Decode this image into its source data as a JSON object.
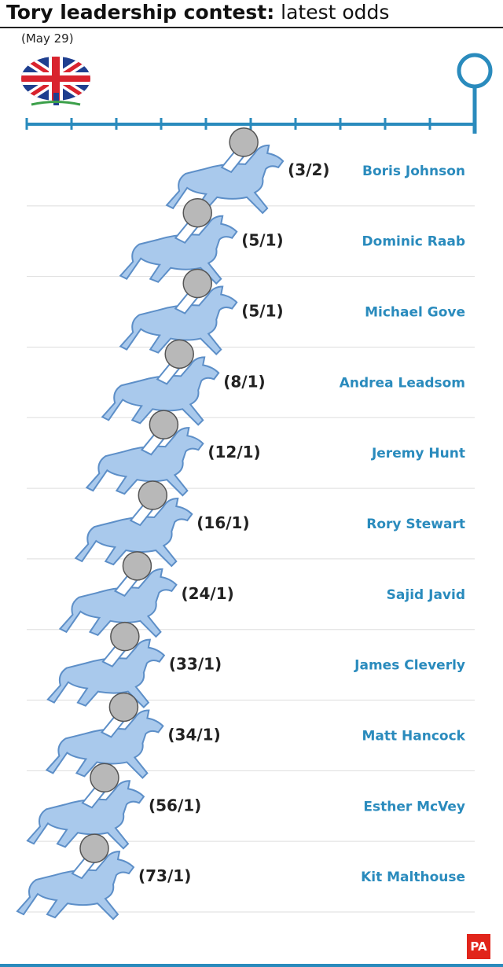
{
  "title": {
    "bold": "Tory leadership contest:",
    "rest": " latest odds"
  },
  "date_note": "(May 29)",
  "colors": {
    "accent": "#2a8bbd",
    "horse": "#a9c9ec",
    "horse_stroke": "#5d8fc8",
    "rule": "#dddddd",
    "pa_red": "#e1251b"
  },
  "icons": [
    "union-jack-tree-logo",
    "finish-post-icon",
    "racehorse-icon",
    "jockey-face-icon"
  ],
  "pa_logo": "PA",
  "chart_data": {
    "type": "bar",
    "title": "Tory leadership contest: latest odds",
    "subtitle": "(May 29)",
    "value_meaning": "betting odds (fractional); shorter odds = further along the race track",
    "categories": [
      "Boris Johnson",
      "Dominic Raab",
      "Michael Gove",
      "Andrea Leadsom",
      "Jeremy Hunt",
      "Rory Stewart",
      "Sajid Javid",
      "James Cleverly",
      "Matt Hancock",
      "Esther McVey",
      "Kit Malthouse"
    ],
    "odds_labels": [
      "(3/2)",
      "(5/1)",
      "(5/1)",
      "(8/1)",
      "(12/1)",
      "(16/1)",
      "(24/1)",
      "(33/1)",
      "(34/1)",
      "(56/1)",
      "(73/1)"
    ],
    "values": [
      1.5,
      5,
      5,
      8,
      12,
      16,
      24,
      33,
      34,
      56,
      73
    ],
    "grid": true,
    "legend": "none"
  }
}
